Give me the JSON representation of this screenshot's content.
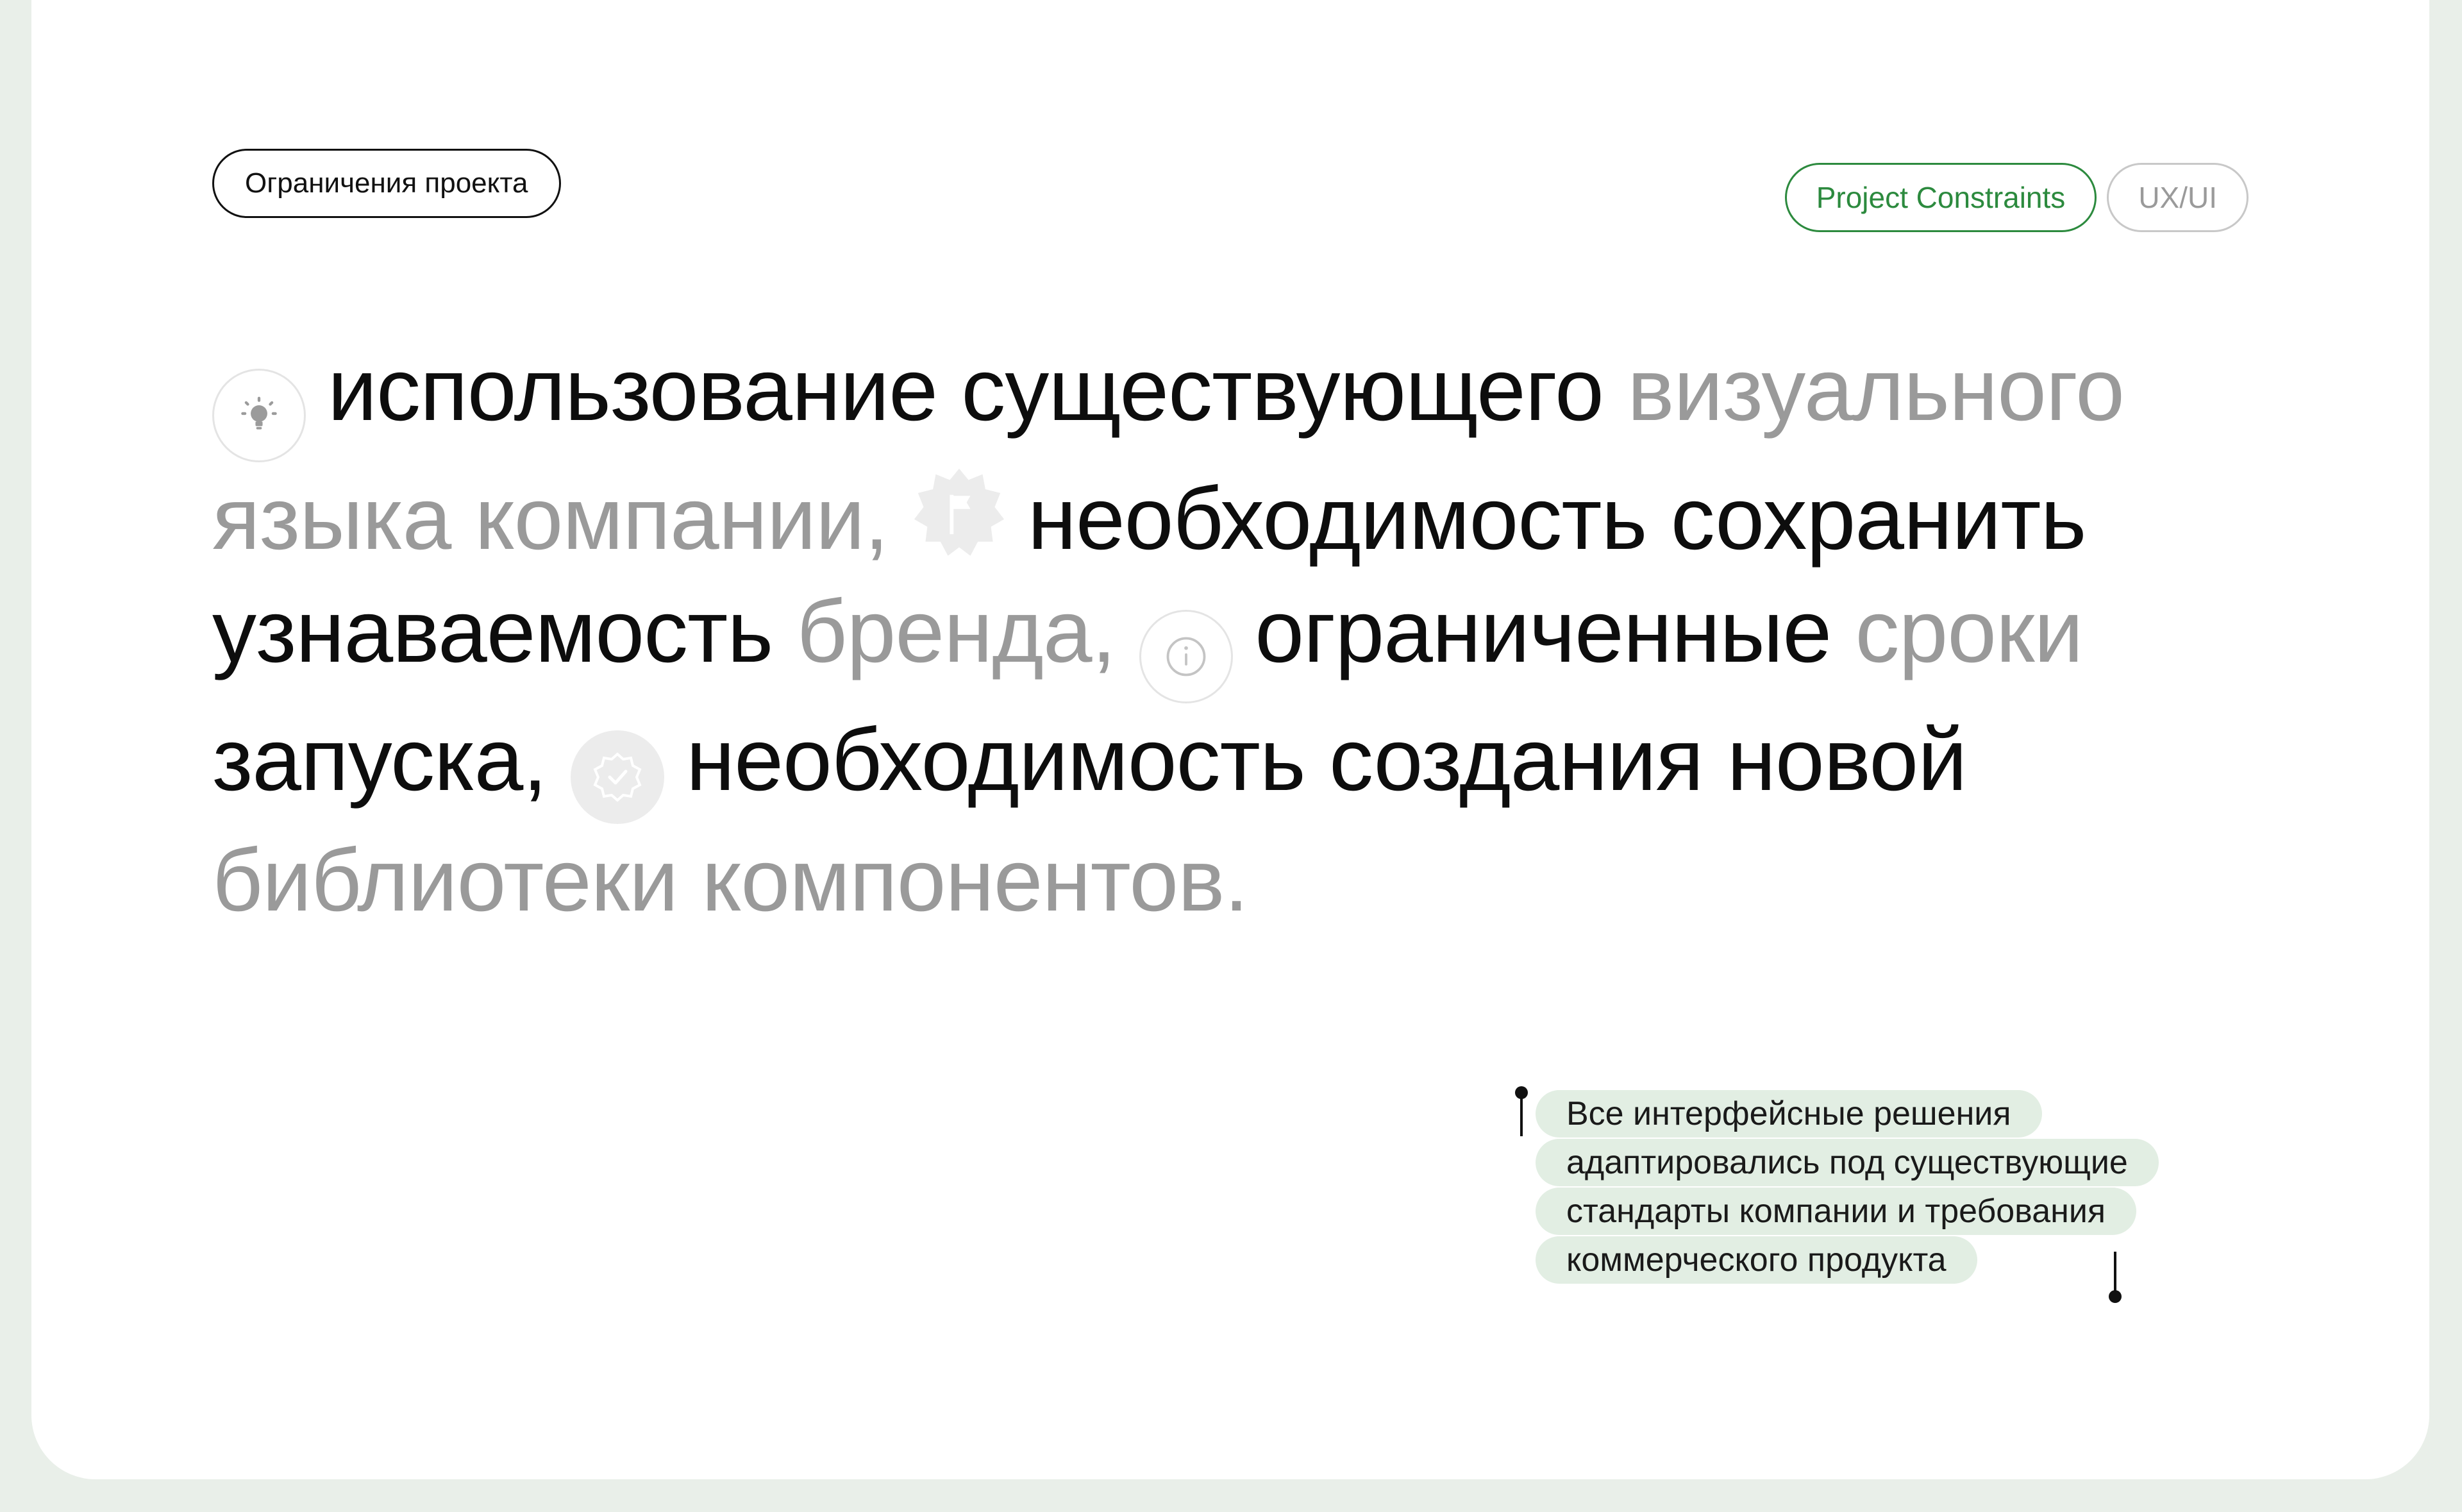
{
  "header": {
    "label": "Ограничения проекта",
    "tags": [
      "Project Constraints",
      "UX/UI"
    ]
  },
  "statement": {
    "items": [
      {
        "icon": "lightbulb-icon",
        "dark": "использование существующего",
        "muted": "визуального языка компании,"
      },
      {
        "icon": "flag-badge-icon",
        "dark": "необходимость сохранить узнаваемость",
        "muted": "бренда,"
      },
      {
        "icon": "info-icon",
        "dark": "ограниченные",
        "muted": "сроки"
      },
      {
        "dark_after": "запуска,"
      },
      {
        "icon": "verified-badge-icon",
        "dark": "необходимость создания новой",
        "muted": "библиотеки компонентов."
      }
    ]
  },
  "note": {
    "lines": [
      "Все интерфейсные решения",
      "адаптировались под существующие",
      "стандарты компании и требования",
      "коммерческого продукта"
    ]
  },
  "colors": {
    "background": "#e9efe9",
    "card": "#ffffff",
    "accent_green": "#2c8a3e",
    "muted_text": "#9a9a9a",
    "note_bg": "#e2eee3"
  }
}
